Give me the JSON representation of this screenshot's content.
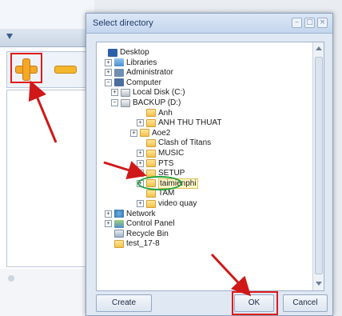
{
  "dialog": {
    "title": "Select directory",
    "window_buttons": [
      "–",
      "□",
      "×"
    ],
    "create_label": "Create",
    "ok_label": "OK",
    "cancel_label": "Cancel"
  },
  "tree": [
    {
      "label": "Desktop",
      "icon": "desktop-icon",
      "expander": ""
    },
    {
      "label": "Libraries",
      "icon": "libraries-icon",
      "expander": "+"
    },
    {
      "label": "Administrator",
      "icon": "user-icon",
      "expander": "+"
    },
    {
      "label": "Computer",
      "icon": "computer-icon",
      "expander": "−"
    },
    {
      "label": "Local Disk (C:)",
      "icon": "drive-icon",
      "expander": "+"
    },
    {
      "label": "BACKUP (D:)",
      "icon": "drive-icon",
      "expander": "−"
    },
    {
      "label": "Anh",
      "icon": "folder-icon",
      "expander": ""
    },
    {
      "label": "ANH THU THUAT",
      "icon": "folder-icon",
      "expander": "+"
    },
    {
      "label": "Aoe2",
      "icon": "folder-icon",
      "expander": "+"
    },
    {
      "label": "Clash of Titans",
      "icon": "folder-icon",
      "expander": ""
    },
    {
      "label": "MUSIC",
      "icon": "folder-icon",
      "expander": "+"
    },
    {
      "label": "PTS",
      "icon": "folder-icon",
      "expander": "+"
    },
    {
      "label": "SETUP",
      "icon": "folder-icon",
      "expander": "+"
    },
    {
      "label": "taimienphi",
      "icon": "folder-icon",
      "expander": "+",
      "selected": true
    },
    {
      "label": "TAM",
      "icon": "folder-icon",
      "expander": ""
    },
    {
      "label": "video quay",
      "icon": "folder-icon",
      "expander": "+"
    },
    {
      "label": "Network",
      "icon": "network-icon",
      "expander": "+"
    },
    {
      "label": "Control Panel",
      "icon": "control-panel-icon",
      "expander": "+"
    },
    {
      "label": "Recycle Bin",
      "icon": "recycle-bin-icon",
      "expander": ""
    },
    {
      "label": "test_17-8",
      "icon": "folder-icon",
      "expander": ""
    }
  ],
  "colors": {
    "highlight_red": "#e01b1b",
    "highlight_green": "#24a13c"
  }
}
